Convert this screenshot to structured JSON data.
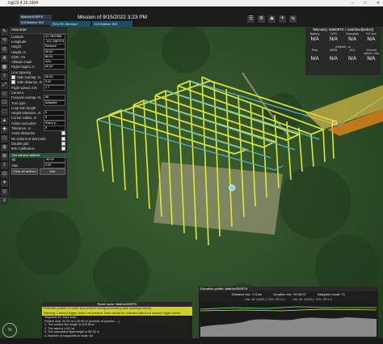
{
  "window": {
    "app_name": "UgCS 4.16.1604",
    "controls": [
      "–",
      "□",
      "✕"
    ]
  },
  "toolbar": {
    "mission_title": "Mission of 9/15/2022 3:23 PM",
    "left_tabs": [
      "Matrice300RTK",
      "DJI Matrice 300"
    ],
    "mission_tabs": [
      "ROUTE-Stendar1",
      "DJI Matrice 300"
    ],
    "icons": [
      "☰",
      "⚙",
      "⛰",
      "✈",
      "⇆"
    ]
  },
  "left_icons": [
    "✎",
    "⟲",
    "◎",
    "⊕",
    "▦",
    "⇧",
    "⤢",
    "◇",
    "☐",
    "⬚",
    "▲",
    "✚",
    "⬡",
    "◍",
    "⊞",
    "⇩",
    "⊡",
    "✦",
    "⊙",
    "≡"
  ],
  "left_panel": {
    "header": "Area scan",
    "rows": [
      {
        "label": "Latitude",
        "value": "41.7807568"
      },
      {
        "label": "Longitude",
        "value": "-141.2387374"
      },
      {
        "label": "Height",
        "value": "Remove"
      },
      {
        "label": "Height, m",
        "value": "80.00"
      },
      {
        "label": "GSD, cm",
        "value": "80.00"
      },
      {
        "label": "Altitude mode",
        "value": "AGL"
      },
      {
        "label": "Flight height, m",
        "value": "80.00"
      },
      {
        "label": "Line Spacing",
        "value": ""
      },
      {
        "label": "Side overlap, %",
        "value": "80.00"
      },
      {
        "label": "Side distance, m",
        "value": "5.00"
      },
      {
        "label": "Flight speed, m/s",
        "value": "1.7"
      },
      {
        "label": "Camera",
        "value": ""
      },
      {
        "label": "Forward overlap, %",
        "value": "80"
      },
      {
        "label": "Turn type",
        "value": "Adaptive"
      },
      {
        "label": "Loop turn length",
        "value": ""
      },
      {
        "label": "Height tolerance, m",
        "value": "5"
      },
      {
        "label": "Corner radius, m",
        "value": "5"
      },
      {
        "label": "Action execution",
        "value": "Every p..."
      },
      {
        "label": "Tolerance, m",
        "value": "5"
      },
      {
        "label": "Avoid obstacles",
        "value": ""
      },
      {
        "label": "No actions at last point",
        "value": ""
      },
      {
        "label": "Double grid",
        "value": ""
      },
      {
        "label": "IMU Calibration",
        "value": ""
      }
    ],
    "camera_section": "Set camera attitude",
    "cam_rows": [
      {
        "label": "Tilt",
        "value": "-90.00"
      },
      {
        "label": "Yaw",
        "value": "0.00"
      }
    ],
    "buttons": [
      "Clear all actions",
      "Add"
    ]
  },
  "telemetry": {
    "title": "Telemetry: M300RTK / undefined(5eb43)",
    "headers": [
      "Battery",
      "GPS",
      "Downlink",
      "RC link"
    ],
    "values": [
      "N/A",
      "N/A",
      "N/A",
      "N/A"
    ],
    "altitude_title": "Altitude, m",
    "headers2": [
      "Raw",
      "AMSL",
      "AGL",
      "Ground speed, m/s"
    ],
    "values2": [
      "N/A",
      "N/A",
      "N/A",
      "N/A"
    ]
  },
  "route_panel": {
    "title": "Route name: Matrice300RTK",
    "warning": [
      "Potential problem in route encountered during processing (see warnings below)",
      "Warning: Camera trigger action not present. Data cannot be collected without a camera trigger action"
    ],
    "lines": [
      "Segment #1: Area scan",
      "Pattern size: 40.00 m x 40.00 m (number of passes: ...)",
      "1. The control line length is 403.66 m",
      "2. The area is 1.60 ha",
      "3. The calculated flight height is 80.00 m",
      "4. Number of waypoints in route: 64"
    ]
  },
  "elevation_panel": {
    "header": "Elevation profile: Matrice300RTK",
    "distance": "Distance est.: 3.3 km",
    "duration": "Duration est.: 00:06:07",
    "waypoints": "Waypoint count: 71",
    "alt_amsl": "max. alt. (AMSL) / AGL: 80.0 m",
    "alt_raw": "min. alt. (AMSL) / AGL: 80.0 m"
  },
  "compass": {
    "label": "N"
  }
}
